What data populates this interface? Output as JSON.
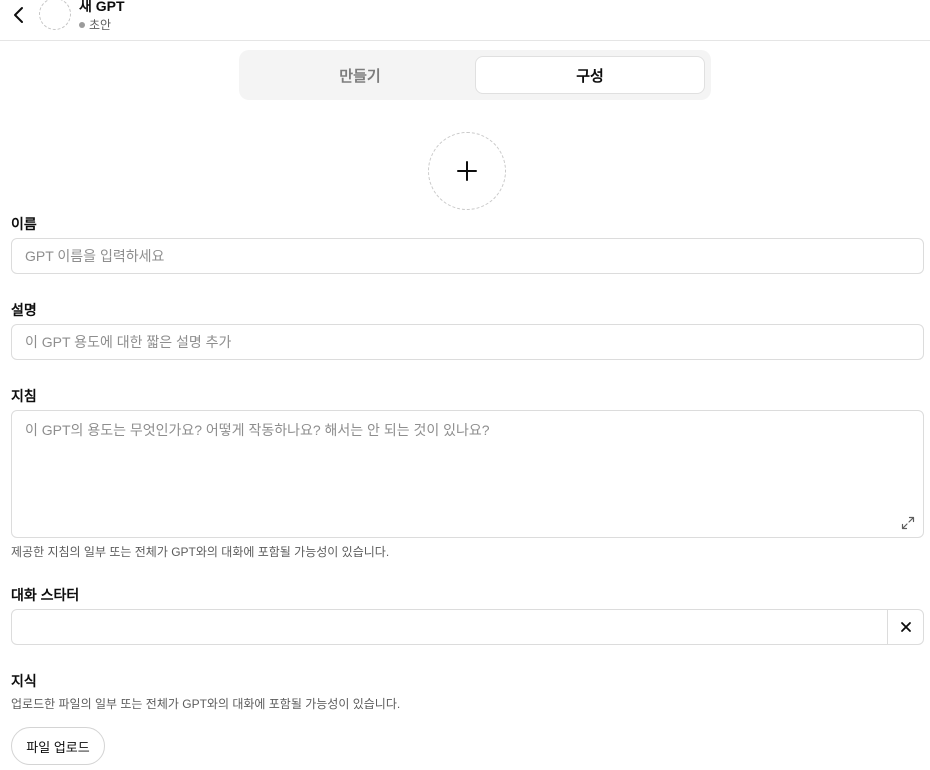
{
  "header": {
    "title": "새 GPT",
    "status": "초안"
  },
  "tabs": [
    {
      "label": "만들기",
      "active": false
    },
    {
      "label": "구성",
      "active": true
    }
  ],
  "form": {
    "name": {
      "label": "이름",
      "value": "",
      "placeholder": "GPT 이름을 입력하세요"
    },
    "description": {
      "label": "설명",
      "value": "",
      "placeholder": "이 GPT 용도에 대한 짧은 설명 추가"
    },
    "instructions": {
      "label": "지침",
      "value": "",
      "placeholder": "이 GPT의 용도는 무엇인가요? 어떻게 작동하나요? 해서는 안 되는 것이 있나요?",
      "hint": "제공한 지침의 일부 또는 전체가 GPT와의 대화에 포함될 가능성이 있습니다."
    },
    "conversation_starters": {
      "label": "대화 스타터",
      "value": ""
    },
    "knowledge": {
      "label": "지식",
      "hint": "업로드한 파일의 일부 또는 전체가 GPT와의 대화에 포함될 가능성이 있습니다.",
      "upload_label": "파일 업로드"
    }
  },
  "icons": {
    "back": "chevron-left-icon",
    "avatar_add": "plus-icon",
    "expand": "expand-icon",
    "remove": "close-icon"
  },
  "colors": {
    "text": "#0d0d0d",
    "muted": "#5d5d5d",
    "placeholder": "#8e8e8e",
    "border": "#dcdcdc",
    "tab_bg": "#f4f4f4"
  }
}
